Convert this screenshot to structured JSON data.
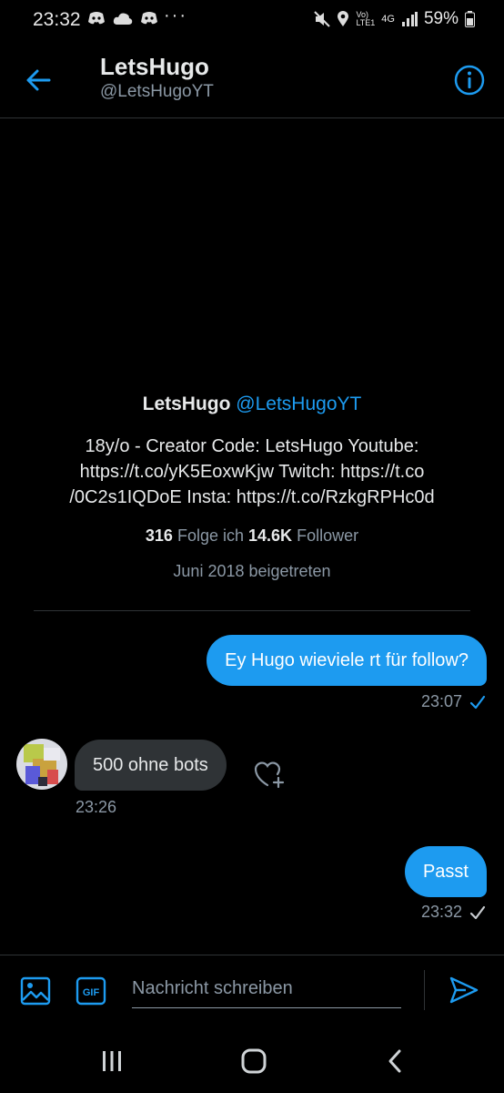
{
  "status_bar": {
    "time": "23:32",
    "dots": "···",
    "network_volte": "Vo)",
    "network_lte": "LTE1",
    "network_type": "4G",
    "battery": "59%"
  },
  "header": {
    "name": "LetsHugo",
    "handle": "@LetsHugoYT"
  },
  "profile": {
    "name": "LetsHugo",
    "handle": "@LetsHugoYT",
    "bio_line1": "18y/o - Creator Code: LetsHugo Youtube:",
    "bio_line2": "https://t.co/yK5EoxwKjw Twitch: https://t.co",
    "bio_line3": "/0C2s1IQDoE Insta: https://t.co/RzkgRPHc0d",
    "following_count": "316",
    "following_label": "Folge ich",
    "followers_count": "14.6K",
    "followers_label": "Follower",
    "joined": "Juni 2018 beigetreten"
  },
  "messages": [
    {
      "direction": "out",
      "text": "Ey Hugo wieviele rt für follow?",
      "time": "23:07",
      "status": "read"
    },
    {
      "direction": "in",
      "text": "500 ohne bots",
      "time": "23:26"
    },
    {
      "direction": "out",
      "text": "Passt",
      "time": "23:32",
      "status": "sent"
    }
  ],
  "composer": {
    "placeholder": "Nachricht schreiben",
    "gif_label": "GIF"
  },
  "colors": {
    "accent": "#1d9bf0",
    "background": "#000000",
    "bubble_in": "#2f3336",
    "secondary_text": "#8b98a5"
  },
  "icons": {
    "back": "arrow-left-icon",
    "info": "info-circle-icon",
    "heart_add": "heart-plus-icon",
    "image": "image-icon",
    "gif": "gif-icon",
    "send": "send-icon",
    "nav_recents": "recents-icon",
    "nav_home": "home-icon",
    "nav_back": "nav-back-icon"
  }
}
